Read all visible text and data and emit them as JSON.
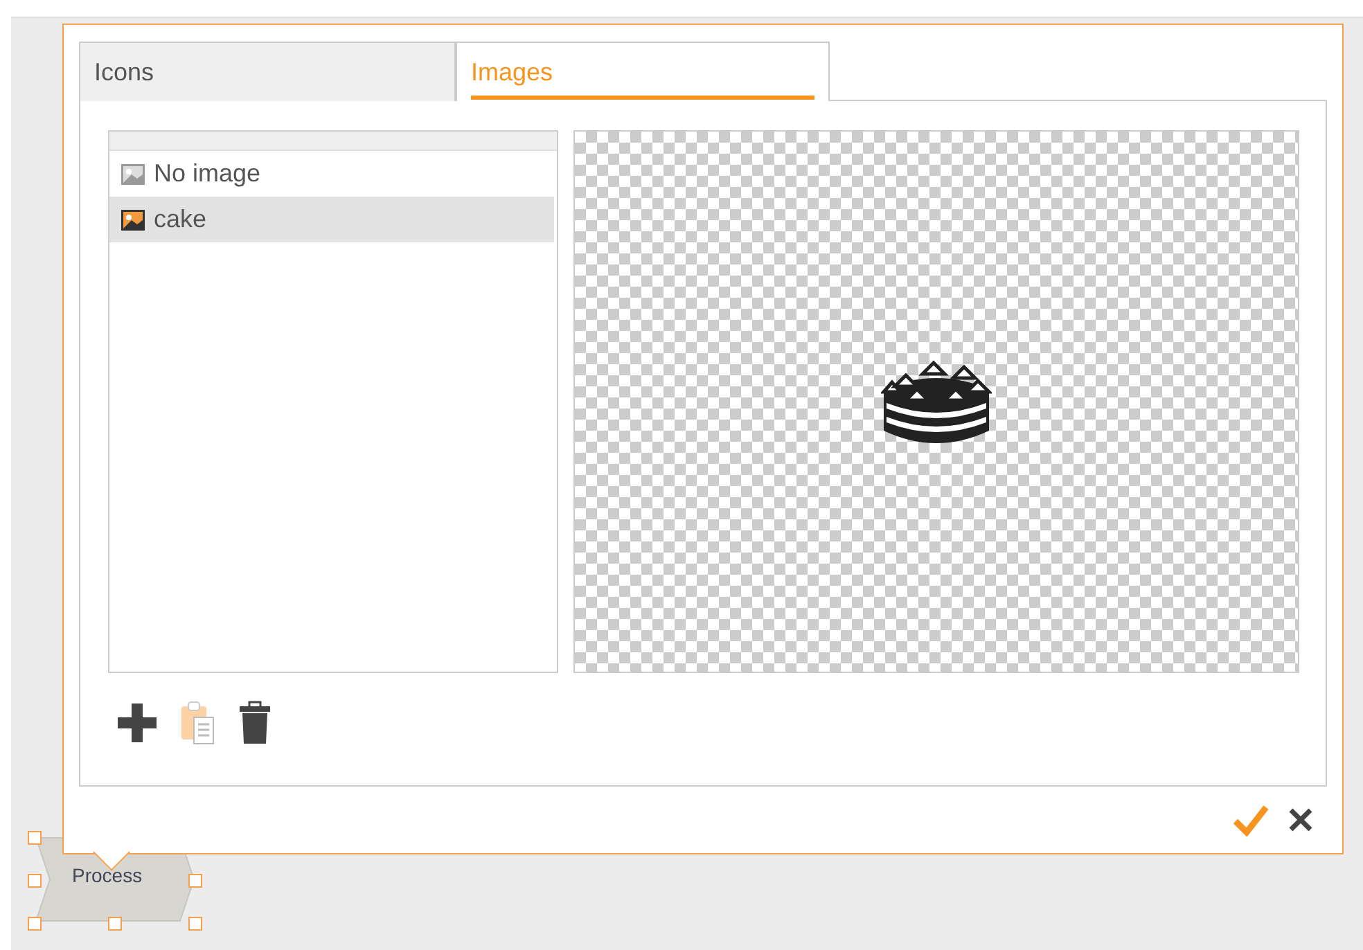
{
  "tabs": [
    {
      "label": "Icons",
      "selected": false
    },
    {
      "label": "Images",
      "selected": true
    }
  ],
  "images": [
    {
      "label": "No image",
      "kind": "empty",
      "selected": false
    },
    {
      "label": "cake",
      "kind": "image",
      "selected": true
    }
  ],
  "toolbar": [
    {
      "kind": "add",
      "disabled": false
    },
    {
      "kind": "paste",
      "disabled": true
    },
    {
      "kind": "delete",
      "disabled": false
    }
  ],
  "node": {
    "label": "Process",
    "selected": true
  }
}
